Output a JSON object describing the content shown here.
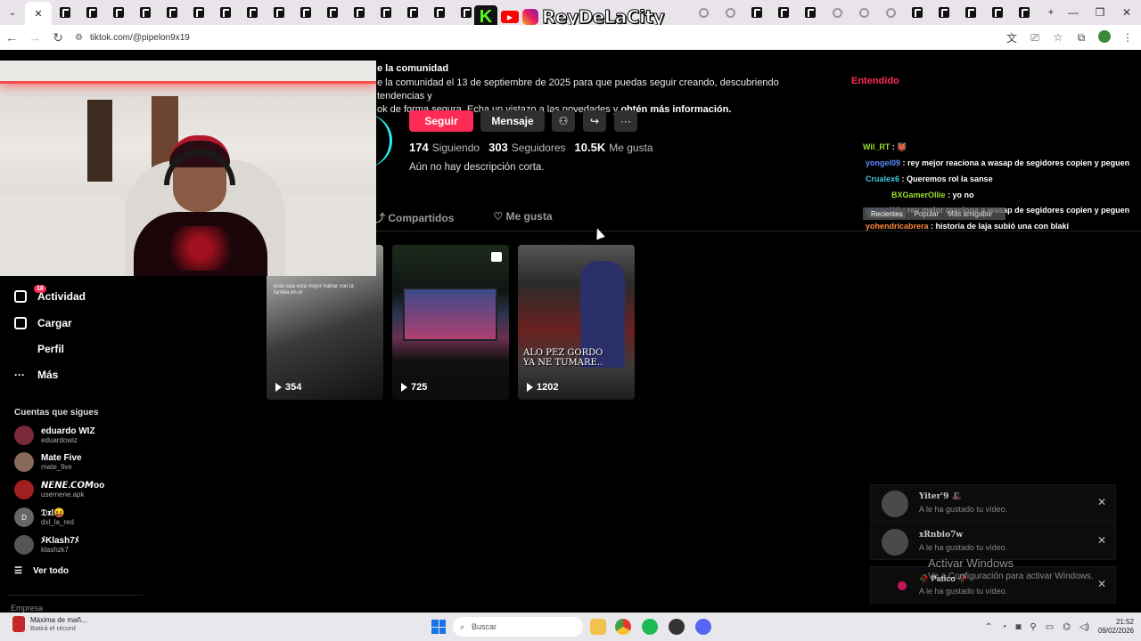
{
  "browser": {
    "url": "tiktok.com/@pipelon9x19",
    "overlay_name": "ReyDeLaCity",
    "kick_letter": "K",
    "youtube_label": "▶"
  },
  "banner": {
    "title": "e la comunidad",
    "text_part1": "e la comunidad el 13 de septiembre de 2025 para que puedas seguir creando, descubriendo tendencias y",
    "text_part2": "ok de forma segura. Echa un vistazo a las novedades y ",
    "text_link": "obtén más información.",
    "dismiss": "Entendido"
  },
  "profile": {
    "follow": "Seguir",
    "message": "Mensaje",
    "add_icon": "⚇",
    "share_icon": "↪",
    "more_icon": "···",
    "following_count": "174",
    "following_label": "Siguiendo",
    "followers_count": "303",
    "followers_label": "Seguidores",
    "likes_count": "10.5K",
    "likes_label": "Me gusta",
    "bio": "Aún no hay descripción corta."
  },
  "tabs": [
    {
      "label": "Compartidos",
      "icon": "⤴"
    },
    {
      "label": "Me gusta",
      "icon": "♡"
    }
  ],
  "videos": [
    {
      "views": "354",
      "caption": "esta sala esta mejor hablar con la familia en el"
    },
    {
      "views": "725"
    },
    {
      "views": "1202",
      "overlay": "ALO PEZ GORDO\nYA NE TUMARE.."
    }
  ],
  "sidebar": {
    "activity": "Actividad",
    "activity_badge": "18",
    "upload": "Cargar",
    "profile": "Perfil",
    "more": "Más",
    "following_header": "Cuentas que sigues",
    "accounts": [
      {
        "name": "eduardo WIZ",
        "user": "eduardowiz"
      },
      {
        "name": "Mate  Five",
        "user": "mate_five"
      },
      {
        "name": "𝙉𝙀𝙉𝙀.𝘾𝙊𝙈oo",
        "user": "usernene.apk"
      },
      {
        "name": "𝔇𝔵𝔩😝",
        "user": "dxl_la_red",
        "initial": "D"
      },
      {
        "name": "ﾒKlash7ﾒ",
        "user": "klashzk7"
      }
    ],
    "see_all": "Ver todo",
    "company": "Empresa"
  },
  "chat": {
    "messages": [
      {
        "user": "Wil_RT",
        "text": " : 👹",
        "color": "#9adf2e"
      },
      {
        "user": "yongel09",
        "text": " : rey mejor reaciona a wasap de segidores copien y peguen",
        "color": "#5b8dff"
      },
      {
        "user": "Crualex6",
        "text": " : Queremos rol la sanse",
        "color": "#3ec8d8"
      },
      {
        "user": "BXGamerOllie",
        "text": " : yo no",
        "color": "#9adf2e"
      },
      {
        "user": "yongel09",
        "text": " : rey mejor reaciona a wasap de segidores copien y peguen",
        "color": "#5b8dff"
      },
      {
        "user": "yohendricabrera",
        "text": " : historia de laja subió una con blaki",
        "color": "#ff8a3d"
      }
    ],
    "tab_recent": "Recientes",
    "tab_popular": "Popular",
    "tab_gifts": "Más amigable"
  },
  "notifications": [
    {
      "name": "Yiter'9 🎩",
      "text": "A le ha gustado tu vídeo."
    },
    {
      "name": "xRnbio7w",
      "text": "A le ha gustado tu vídeo."
    },
    {
      "name": "🥀 Patico 🥀",
      "text": "A le ha gustado tu vídeo."
    }
  ],
  "windows_watermark": {
    "title": "Activar Windows",
    "subtitle": "Ve a Configuración para activar Windows."
  },
  "taskbar": {
    "news_title": "Máxima de mañ...",
    "news_sub": "Batirá el récord",
    "search": "Buscar",
    "time": "21:52",
    "date": "09/02/2026"
  }
}
